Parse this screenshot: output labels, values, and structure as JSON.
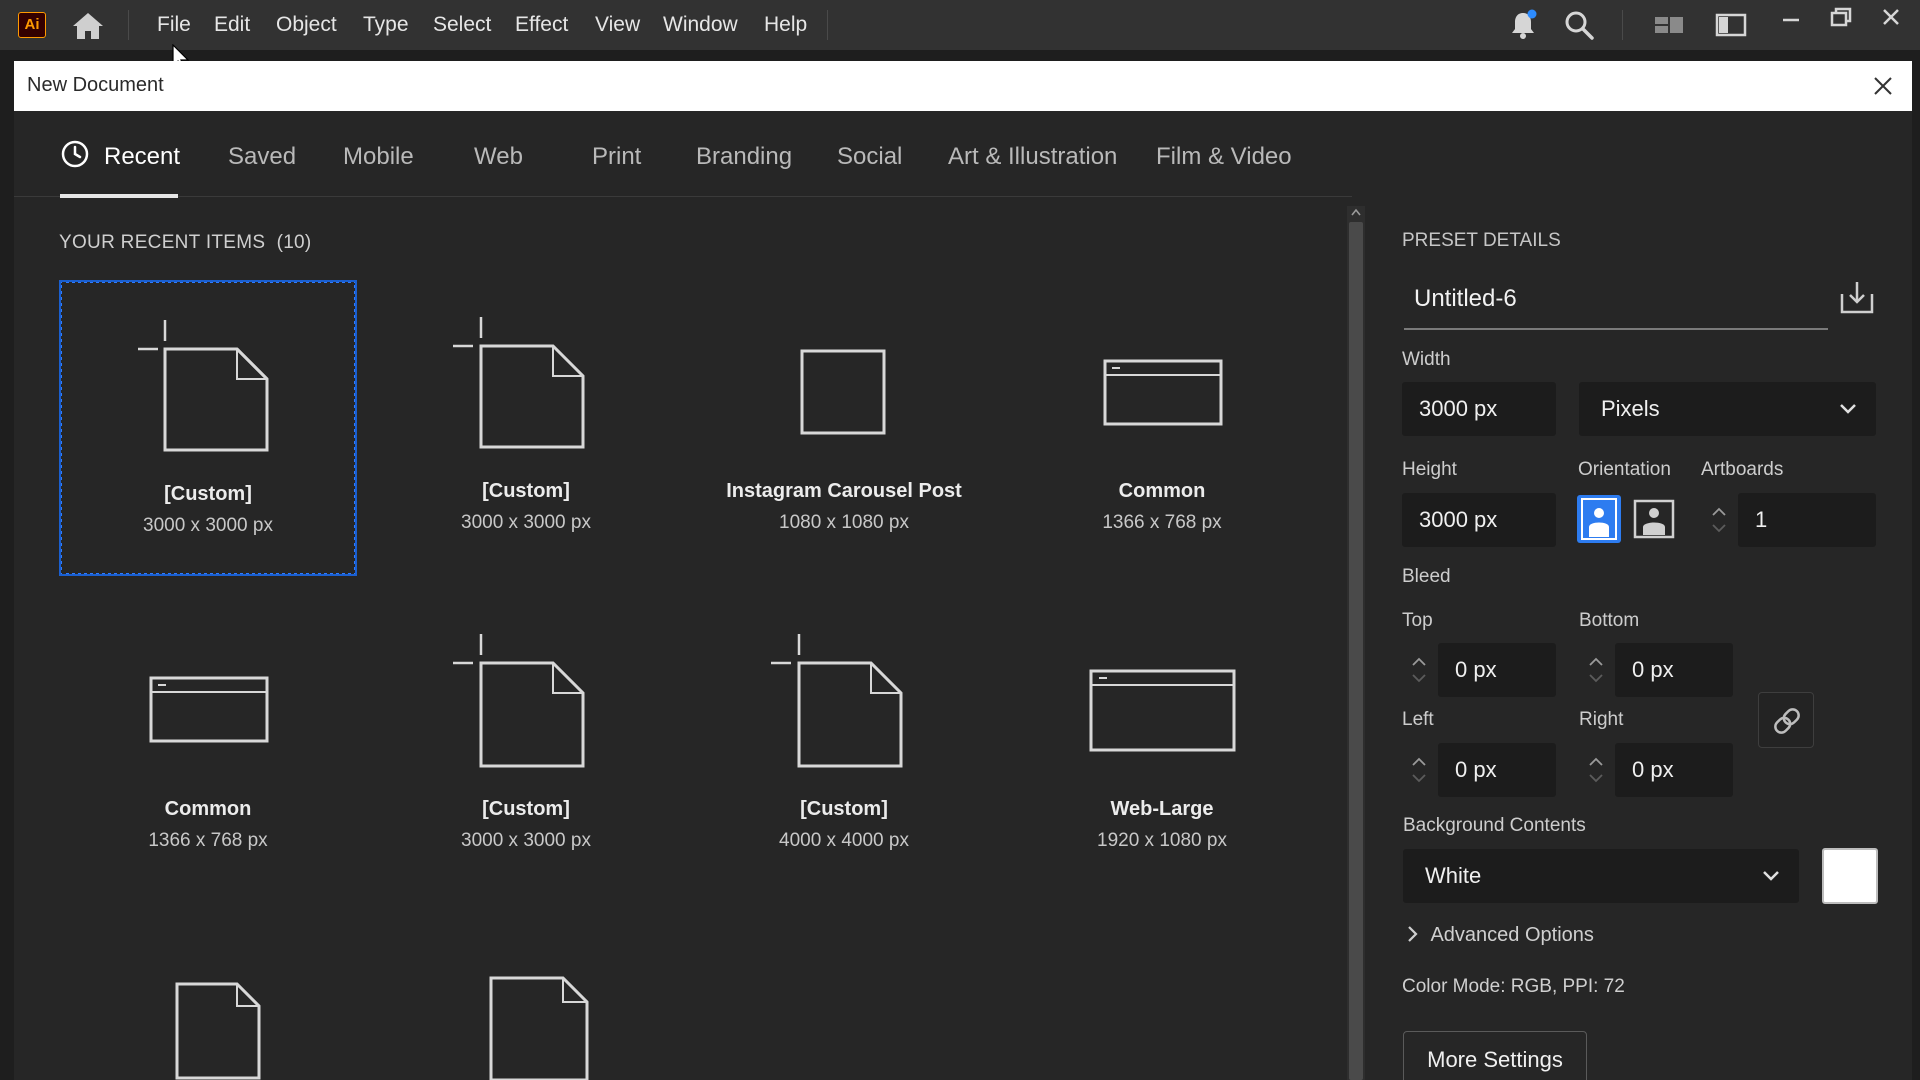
{
  "app": {
    "logo_text": "Ai",
    "accent": "#ff9a00"
  },
  "menu": [
    "File",
    "Edit",
    "Object",
    "Type",
    "Select",
    "Effect",
    "View",
    "Window",
    "Help"
  ],
  "dialog": {
    "title": "New Document"
  },
  "tabs": [
    {
      "label": "Recent",
      "active": true
    },
    {
      "label": "Saved"
    },
    {
      "label": "Mobile"
    },
    {
      "label": "Web"
    },
    {
      "label": "Print"
    },
    {
      "label": "Branding"
    },
    {
      "label": "Social"
    },
    {
      "label": "Art & Illustration"
    },
    {
      "label": "Film & Video"
    }
  ],
  "recent": {
    "title": "YOUR RECENT ITEMS",
    "count": "(10)",
    "items": [
      {
        "name": "[Custom]",
        "size": "3000 x 3000 px",
        "icon": "custom-doc-icon",
        "selected": true
      },
      {
        "name": "[Custom]",
        "size": "3000 x 3000 px",
        "icon": "custom-doc-icon"
      },
      {
        "name": "Instagram Carousel Post",
        "size": "1080 x 1080 px",
        "icon": "square-doc-icon"
      },
      {
        "name": "Common",
        "size": "1366 x 768 px",
        "icon": "web-doc-icon"
      },
      {
        "name": "Common",
        "size": "1366 x 768 px",
        "icon": "web-doc-icon"
      },
      {
        "name": "[Custom]",
        "size": "3000 x 3000 px",
        "icon": "custom-doc-icon"
      },
      {
        "name": "[Custom]",
        "size": "4000 x 4000 px",
        "icon": "custom-doc-icon"
      },
      {
        "name": "Web-Large",
        "size": "1920 x 1080 px",
        "icon": "web-doc-icon"
      }
    ]
  },
  "preset": {
    "title": "PRESET DETAILS",
    "name": "Untitled-6",
    "width_label": "Width",
    "width": "3000 px",
    "units": "Pixels",
    "height_label": "Height",
    "height": "3000 px",
    "orientation_label": "Orientation",
    "orientation": "portrait",
    "artboards_label": "Artboards",
    "artboards": "1",
    "bleed_label": "Bleed",
    "top_label": "Top",
    "top": "0 px",
    "bottom_label": "Bottom",
    "bottom": "0 px",
    "left_label": "Left",
    "left": "0 px",
    "right_label": "Right",
    "right": "0 px",
    "bg_label": "Background Contents",
    "bg_value": "White",
    "bg_color": "#ffffff",
    "advanced": "Advanced Options",
    "color_mode": "Color Mode: RGB, PPI: 72",
    "more_settings": "More Settings"
  }
}
